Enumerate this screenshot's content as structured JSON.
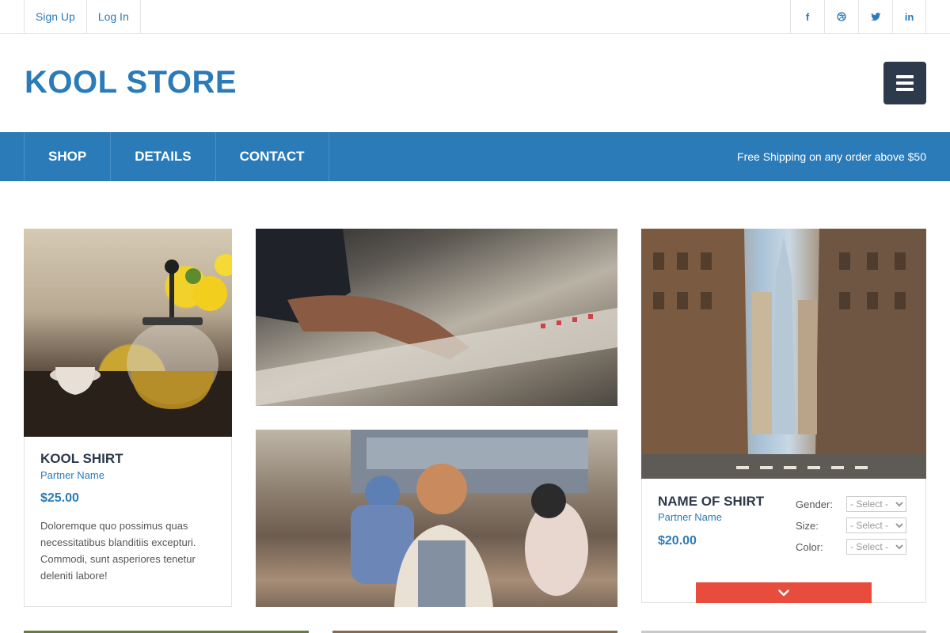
{
  "topbar": {
    "signup": "Sign Up",
    "login": "Log In",
    "social": [
      {
        "name": "facebook-icon",
        "glyph": "f"
      },
      {
        "name": "dribbble-icon",
        "glyph": "◎"
      },
      {
        "name": "twitter-icon",
        "glyph": "🐦"
      },
      {
        "name": "linkedin-icon",
        "glyph": "in"
      }
    ]
  },
  "header": {
    "logo": "KOOL STORE",
    "menu_icon": "hamburger-icon"
  },
  "nav": {
    "items": [
      "SHOP",
      "DETAILS",
      "CONTACT"
    ],
    "shipping": "Free Shipping on any order above $50"
  },
  "products": [
    {
      "title": "KOOL SHIRT",
      "partner": "Partner Name",
      "price": "$25.00",
      "description": "Doloremque quo possimus quas necessitatibus blanditiis excepturi. Commodi, sunt asperiores tenetur deleniti labore!"
    },
    {
      "title": "NAME OF SHIRT",
      "partner": "Partner Name",
      "price": "$20.00",
      "options": [
        {
          "label": "Gender:",
          "value": "- Select -"
        },
        {
          "label": "Size:",
          "value": "- Select -"
        },
        {
          "label": "Color:",
          "value": "- Select -"
        }
      ],
      "expand_icon": "chevron-down-icon"
    }
  ],
  "colors": {
    "brand_blue": "#2b7bb9",
    "dark_navy": "#2d3a4b",
    "accent_red": "#e74c3c"
  }
}
